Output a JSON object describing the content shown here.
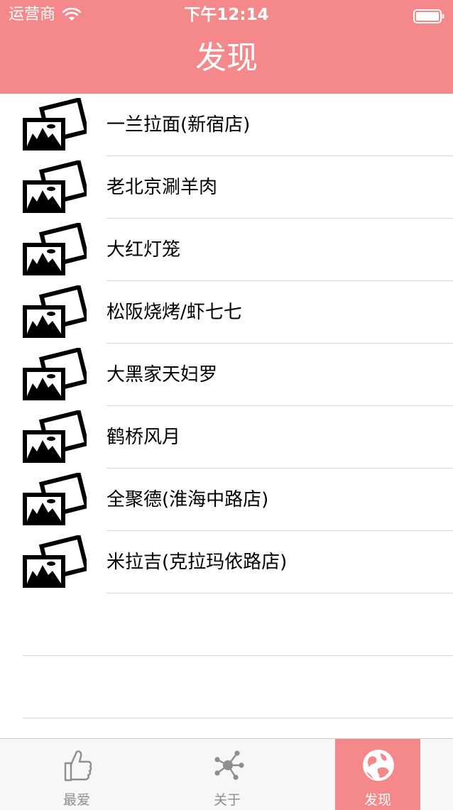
{
  "status_bar": {
    "carrier": "运营商",
    "time": "下午12:14"
  },
  "nav": {
    "title": "发现"
  },
  "list": {
    "items": [
      {
        "label": "一兰拉面(新宿店)"
      },
      {
        "label": "老北京涮羊肉"
      },
      {
        "label": "大红灯笼"
      },
      {
        "label": "松阪烧烤/虾七七"
      },
      {
        "label": "大黑家天妇罗"
      },
      {
        "label": "鹤桥风月"
      },
      {
        "label": "全聚德(淮海中路店)"
      },
      {
        "label": "米拉吉(克拉玛依路店)"
      }
    ]
  },
  "tabbar": {
    "tabs": [
      {
        "label": "最爱",
        "icon": "thumbs-up-icon"
      },
      {
        "label": "关于",
        "icon": "network-icon"
      },
      {
        "label": "发现",
        "icon": "globe-icon",
        "active": true
      }
    ]
  },
  "colors": {
    "accent": "#f4888a",
    "separator": "#d6d6d6",
    "tab_inactive": "#8e8e8e"
  }
}
